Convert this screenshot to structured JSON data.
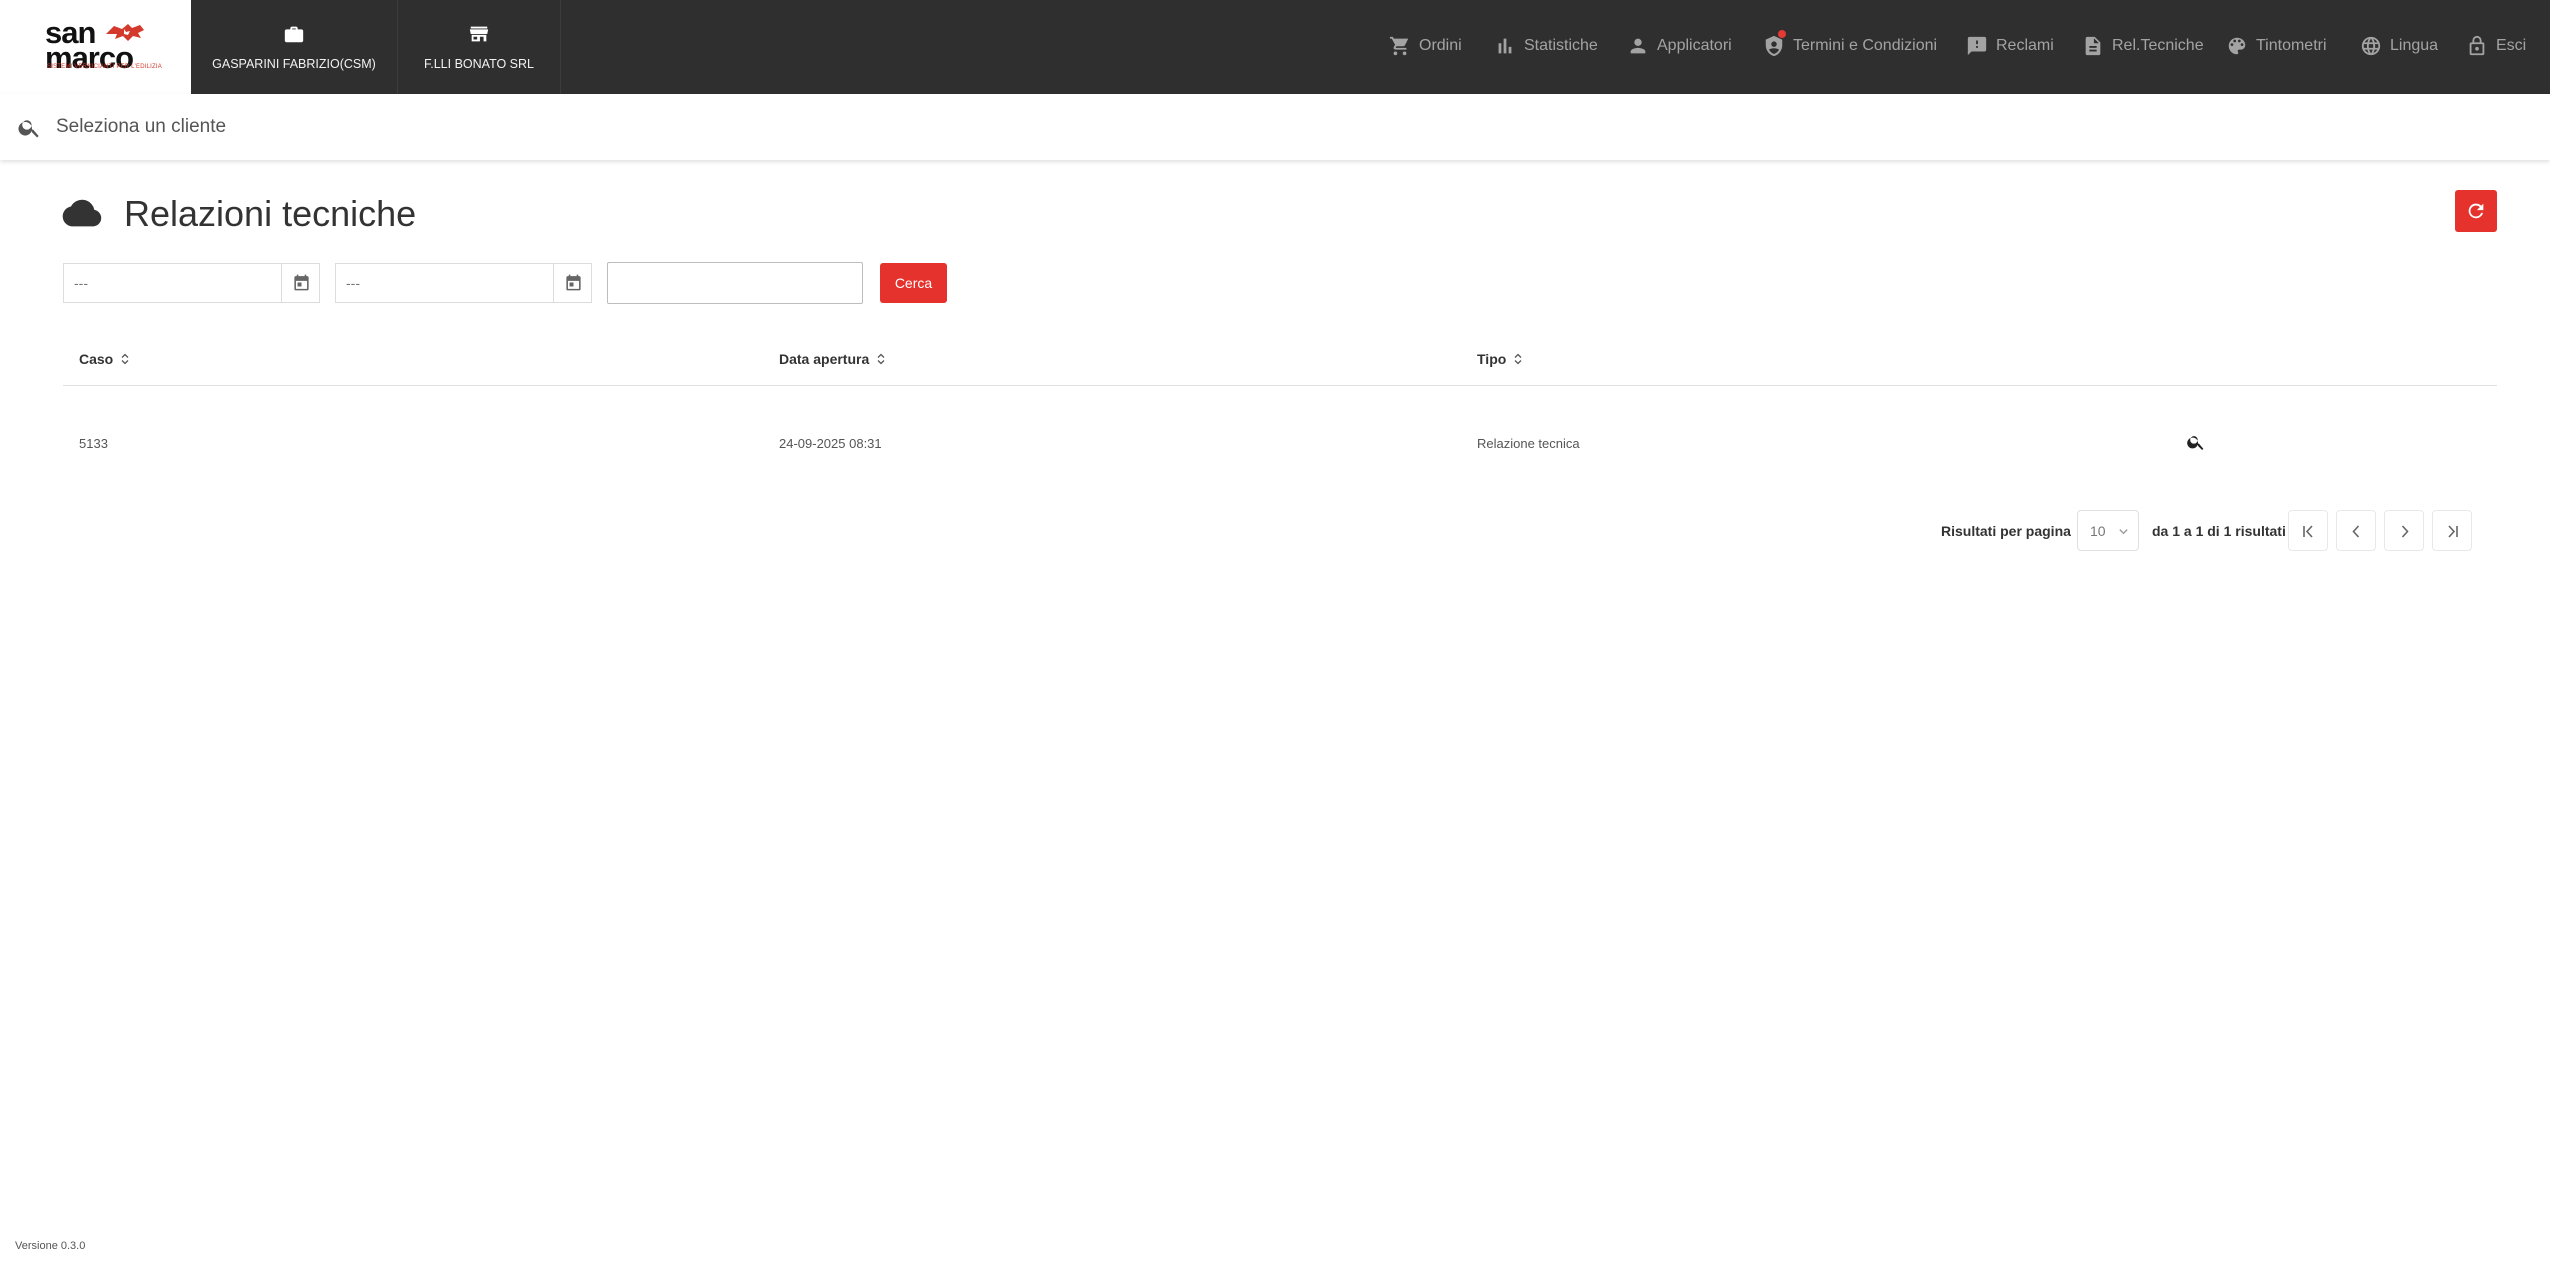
{
  "logo": {
    "name": "san marco",
    "tagline": "SISTEMI VERNICIANTI PER L'EDILIZIA"
  },
  "context": {
    "user_label": "GASPARINI FABRIZIO(CSM)",
    "company_label": "F.LLI BONATO SRL"
  },
  "nav": {
    "items": [
      {
        "label": "Ordini",
        "icon": "cart-icon"
      },
      {
        "label": "Statistiche",
        "icon": "bar-chart-icon"
      },
      {
        "label": "Applicatori",
        "icon": "person-icon"
      },
      {
        "label": "Termini e Condizioni",
        "icon": "shield-icon"
      },
      {
        "label": "Reclami",
        "icon": "feedback-icon"
      },
      {
        "label": "Rel.Tecniche",
        "icon": "document-icon"
      },
      {
        "label": "Tintometri",
        "icon": "palette-icon"
      },
      {
        "label": "Lingua",
        "icon": "globe-icon"
      },
      {
        "label": "Esci",
        "icon": "lock-icon"
      }
    ]
  },
  "search": {
    "placeholder": "Seleziona un cliente",
    "value": ""
  },
  "page": {
    "title": "Relazioni tecniche",
    "icon": "cloud-icon"
  },
  "filters": {
    "date_from_placeholder": "---",
    "date_to_placeholder": "---",
    "text_value": "",
    "search_button": "Cerca"
  },
  "table": {
    "columns": [
      "Caso",
      "Data apertura",
      "Tipo"
    ],
    "rows": [
      {
        "caso": "5133",
        "data_apertura": "24-09-2025 08:31",
        "tipo": "Relazione tecnica"
      }
    ]
  },
  "pagination": {
    "per_page_label": "Risultati per pagina",
    "per_page_value": "10",
    "summary": "da 1 a 1 di 1 risultati"
  },
  "footer": {
    "version": "Versione 0.3.0"
  },
  "colors": {
    "topbar": "#2f2f2f",
    "accent": "#e5322d",
    "nav_text": "#a3a3a3"
  }
}
